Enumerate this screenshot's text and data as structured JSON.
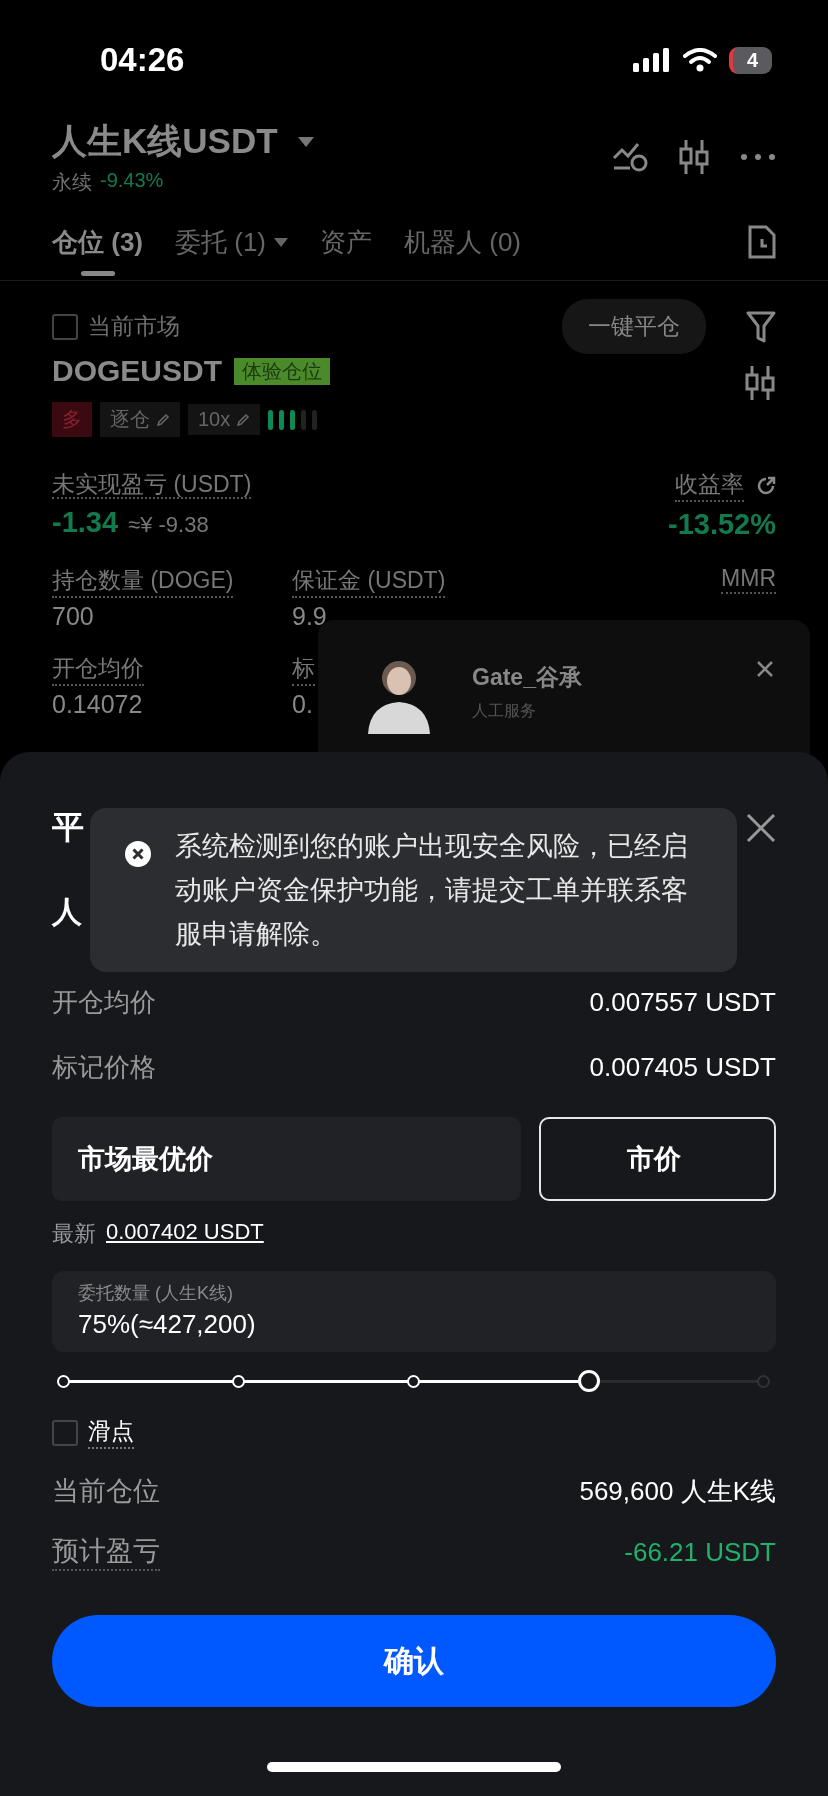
{
  "status_bar": {
    "time": "04:26",
    "battery": "4"
  },
  "header": {
    "title": "人生K线USDT",
    "subtitle": "永续",
    "change": "-9.43%"
  },
  "tabs": [
    {
      "label": "仓位 (3)",
      "selected": true,
      "dropdown": false
    },
    {
      "label": "委托 (1)",
      "selected": false,
      "dropdown": true
    },
    {
      "label": "资产",
      "selected": false,
      "dropdown": false
    },
    {
      "label": "机器人 (0)",
      "selected": false,
      "dropdown": false
    }
  ],
  "filter": {
    "label": "当前市场",
    "checked": false,
    "close_all": "一键平仓"
  },
  "position": {
    "symbol": "DOGEUSDT",
    "badge": "体验仓位",
    "side": "多",
    "margin_mode": "逐仓",
    "leverage": "10x",
    "risk": {
      "level": 0.6
    },
    "pnl_label": "未实现盈亏 (USDT)",
    "pnl": "-1.34",
    "pnl_cny": "≈¥ -9.38",
    "roe_label": "收益率",
    "roe": "-13.52%",
    "stats": [
      {
        "label": "持仓数量 (DOGE)",
        "value": "700"
      },
      {
        "label": "保证金 (USDT)",
        "value": "9.9"
      },
      {
        "label": "MMR"
      },
      {
        "label": "开仓均价",
        "value": "0.14072"
      },
      {
        "label": "标",
        "value": "0."
      }
    ]
  },
  "chat": {
    "name": "Gate_谷承",
    "subtitle": "人工服务"
  },
  "sheet": {
    "title": "平",
    "symbol": "人",
    "rows": [
      {
        "label": "开仓均价",
        "value": "0.007557 USDT"
      },
      {
        "label": "标记价格",
        "value": "0.007405 USDT"
      }
    ],
    "price_types": [
      {
        "label": "市场最优价",
        "selected": false
      },
      {
        "label": "市价",
        "selected": true
      }
    ],
    "latest_label": "最新",
    "latest_value": "0.007402 USDT",
    "amount": {
      "label": "委托数量 (人生K线)",
      "value": "75%(≈427,200)"
    },
    "slider": {
      "level": 0.75
    },
    "slippage": {
      "label": "滑点",
      "checked": false
    },
    "summary": [
      {
        "label": "当前仓位",
        "value": "569,600 人生K线",
        "kind": "plain"
      },
      {
        "label": "预计盈亏",
        "value": "-66.21 USDT",
        "kind": "pnl"
      }
    ],
    "confirm": "确认"
  },
  "toast": {
    "message": "系统检测到您的账户出现安全风险，已经启动账户资金保护功能，请提交工单并联系客服申请解除。"
  }
}
